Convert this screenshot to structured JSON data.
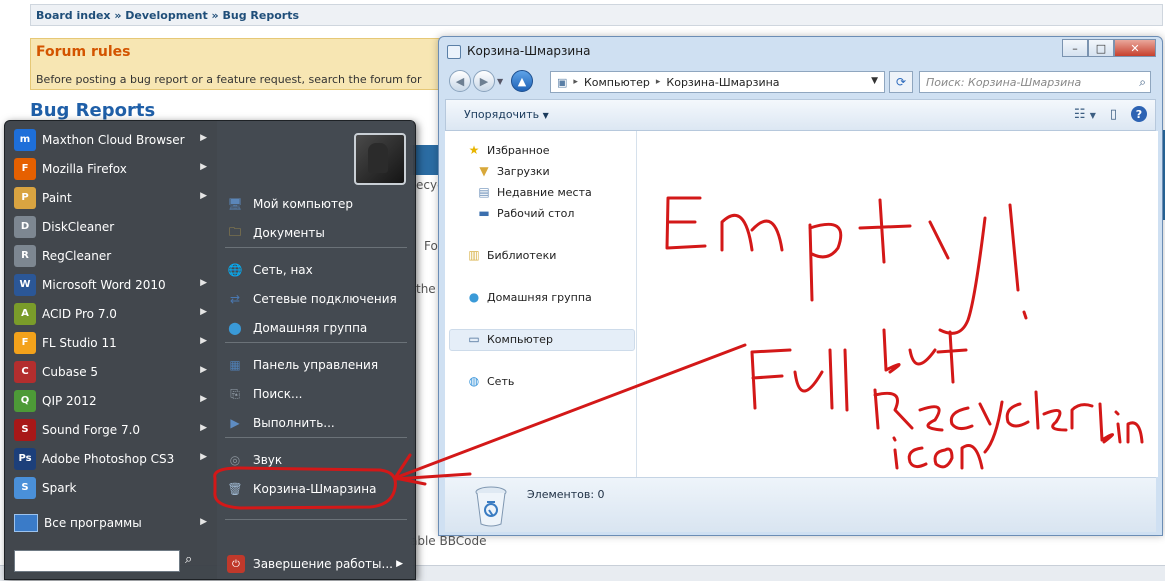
{
  "background_page": {
    "breadcrumb": "Board index » Development » Bug Reports",
    "forum_rules_title": "Forum rules",
    "forum_rules_text": "Before posting a bug report or a feature request, search the forum for",
    "heading": "Bug Reports",
    "fragments": {
      "recycle": "ecycl",
      "fo": "Fo",
      "the": "the",
      "bbcode": "able BBCode"
    }
  },
  "explorer": {
    "title": "Корзина-Шмарзина",
    "address": [
      "Компьютер",
      "Корзина-Шмарзина"
    ],
    "search_placeholder": "Поиск: Корзина-Шмарзина",
    "organize_label": "Упорядочить",
    "nav": {
      "favorites": "Избранное",
      "downloads": "Загрузки",
      "recent": "Недавние места",
      "desktop": "Рабочий стол",
      "libraries": "Библиотеки",
      "homegroup": "Домашняя группа",
      "computer": "Компьютер",
      "network": "Сеть"
    },
    "status": "Элементов: 0"
  },
  "start_menu": {
    "programs": [
      {
        "label": "Maxthon Cloud Browser",
        "icon": "maxthon-icon",
        "color": "#1e6fd9",
        "glyph": "m",
        "arrow": true
      },
      {
        "label": "Mozilla Firefox",
        "icon": "firefox-icon",
        "color": "#e66000",
        "glyph": "F",
        "arrow": true
      },
      {
        "label": "Paint",
        "icon": "paint-icon",
        "color": "#d9a441",
        "glyph": "P",
        "arrow": true
      },
      {
        "label": "DiskCleaner",
        "icon": "diskcleaner-icon",
        "color": "#7d8791",
        "glyph": "D",
        "arrow": false
      },
      {
        "label": "RegCleaner",
        "icon": "regcleaner-icon",
        "color": "#7d8791",
        "glyph": "R",
        "arrow": false
      },
      {
        "label": "Microsoft Word 2010",
        "icon": "word-icon",
        "color": "#2b5797",
        "glyph": "W",
        "arrow": true
      },
      {
        "label": "ACID Pro 7.0",
        "icon": "acid-icon",
        "color": "#7a9c2a",
        "glyph": "A",
        "arrow": true
      },
      {
        "label": "FL Studio 11",
        "icon": "flstudio-icon",
        "color": "#f3a21b",
        "glyph": "F",
        "arrow": true
      },
      {
        "label": "Cubase 5",
        "icon": "cubase-icon",
        "color": "#b32e2e",
        "glyph": "C",
        "arrow": true
      },
      {
        "label": "QIP 2012",
        "icon": "qip-icon",
        "color": "#4d9a37",
        "glyph": "Q",
        "arrow": true
      },
      {
        "label": "Sound Forge 7.0",
        "icon": "soundforge-icon",
        "color": "#a81818",
        "glyph": "S",
        "arrow": true
      },
      {
        "label": "Adobe Photoshop CS3",
        "icon": "photoshop-icon",
        "color": "#1c3f7a",
        "glyph": "Ps",
        "arrow": true
      },
      {
        "label": "Spark",
        "icon": "spark-icon",
        "color": "#4a90d9",
        "glyph": "S",
        "arrow": false
      }
    ],
    "all_programs": "Все программы",
    "right_items": [
      {
        "label": "Мой компьютер",
        "icon": "computer-icon",
        "glyph": "🖥",
        "color": "#5b86b8"
      },
      {
        "label": "Документы",
        "icon": "documents-icon",
        "glyph": "🗀",
        "color": "#d8b24a"
      },
      {
        "label": "Сеть, нах",
        "icon": "network-globe-icon",
        "glyph": "🌐",
        "color": "#3a8fd8"
      },
      {
        "label": "Сетевые подключения",
        "icon": "network-connections-icon",
        "glyph": "⇄",
        "color": "#4a78b0"
      },
      {
        "label": "Домашняя группа",
        "icon": "homegroup-icon",
        "glyph": "⬤",
        "color": "#3a9ad8"
      },
      {
        "label": "Панель управления",
        "icon": "control-panel-icon",
        "glyph": "▦",
        "color": "#4f7fb5"
      },
      {
        "label": "Поиск...",
        "icon": "search-files-icon",
        "glyph": "⎘",
        "color": "#9aa5b1"
      },
      {
        "label": "Выполнить...",
        "icon": "run-icon",
        "glyph": "▶",
        "color": "#5e8cc2"
      },
      {
        "label": "Звук",
        "icon": "sound-icon",
        "glyph": "◎",
        "color": "#8c949c"
      },
      {
        "label": "Корзина-Шмарзина",
        "icon": "recycle-bin-icon",
        "glyph": "🗑",
        "color": "#9fb8d1"
      }
    ],
    "shutdown": "Завершение работы..."
  },
  "annotation": {
    "ink_color": "#d31818",
    "words": [
      "Empty!",
      "but",
      "Full",
      "Recycler",
      "bin",
      "icon"
    ]
  }
}
